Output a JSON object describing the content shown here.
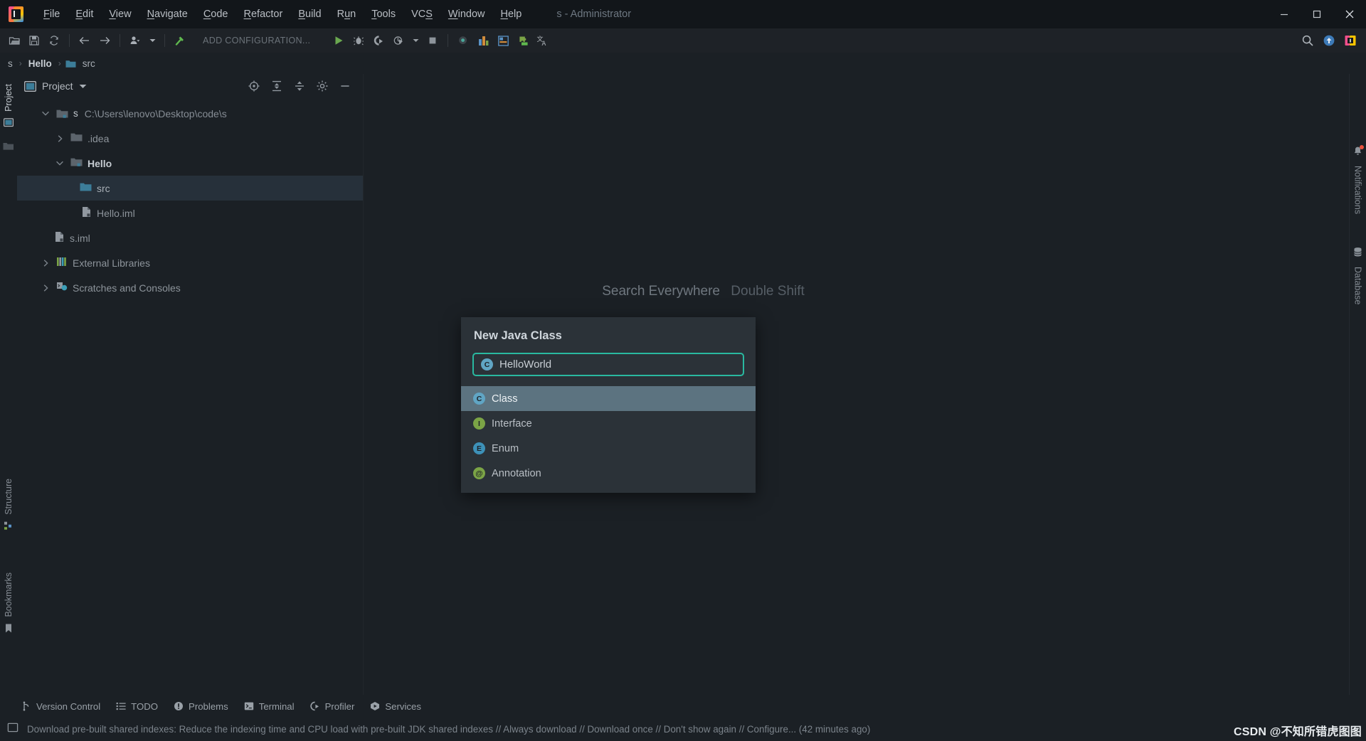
{
  "window": {
    "title": "s - Administrator",
    "controls": [
      "minimize",
      "maximize",
      "close"
    ]
  },
  "menubar": {
    "logo": "intellij-idea-logo",
    "items": [
      {
        "label": "File",
        "mnemonic": "F"
      },
      {
        "label": "Edit",
        "mnemonic": "E"
      },
      {
        "label": "View",
        "mnemonic": "V"
      },
      {
        "label": "Navigate",
        "mnemonic": "N"
      },
      {
        "label": "Code",
        "mnemonic": "C"
      },
      {
        "label": "Refactor",
        "mnemonic": "R"
      },
      {
        "label": "Build",
        "mnemonic": "B"
      },
      {
        "label": "Run",
        "mnemonic": "u"
      },
      {
        "label": "Tools",
        "mnemonic": "T"
      },
      {
        "label": "VCS",
        "mnemonic": "S"
      },
      {
        "label": "Window",
        "mnemonic": "W"
      },
      {
        "label": "Help",
        "mnemonic": "H"
      }
    ]
  },
  "toolbar": {
    "add_configuration": "ADD CONFIGURATION...",
    "icons_left": [
      "open-folder-icon",
      "save-icon",
      "sync-icon",
      "back-arrow-icon",
      "forward-arrow-icon",
      "user-icon",
      "build-hammer-icon"
    ],
    "icons_run": [
      "run-icon",
      "debug-icon",
      "run-with-coverage-icon",
      "profile-icon",
      "stop-icon"
    ],
    "icons_extra": [
      "search-everywhere-icon",
      "layout-icon",
      "ui-designer-icon",
      "plugin-icon",
      "translate-icon"
    ],
    "icons_right": [
      "search-icon",
      "update-project-icon",
      "ide-icon"
    ]
  },
  "breadcrumb": {
    "items": [
      {
        "label": "s",
        "style": "plain"
      },
      {
        "label": "Hello",
        "style": "bold"
      },
      {
        "label": "src",
        "style": "folder"
      }
    ],
    "separator": "›"
  },
  "project_panel": {
    "title": "Project",
    "view_icon": "project-view-icon",
    "chevron": "▾",
    "actions": [
      "select-opened-file-icon",
      "expand-all-icon",
      "collapse-all-icon",
      "settings-gear-icon",
      "hide-panel-icon"
    ],
    "tree": [
      {
        "label": "C:\\Users\\lenovo\\Desktop\\code\\s",
        "module": "s",
        "indent": 0,
        "state": "expanded",
        "icon": "module-folder-icon",
        "style": "path",
        "selected": false
      },
      {
        "label": ".idea",
        "indent": 1,
        "state": "collapsed",
        "icon": "folder-icon",
        "style": "dim",
        "selected": false
      },
      {
        "label": "Hello",
        "indent": 1,
        "state": "expanded",
        "icon": "module-folder-icon",
        "style": "bold",
        "selected": false
      },
      {
        "label": "src",
        "indent": 2,
        "state": "leaf",
        "icon": "source-folder-icon",
        "style": "normal",
        "selected": true
      },
      {
        "label": "Hello.iml",
        "indent": 2,
        "state": "leaf",
        "icon": "iml-file-icon",
        "style": "dim",
        "selected": false
      },
      {
        "label": "s.iml",
        "indent": 1,
        "state": "leaf",
        "icon": "iml-file-icon",
        "style": "dim",
        "selected": false
      },
      {
        "label": "External Libraries",
        "indent": 0,
        "state": "collapsed",
        "icon": "external-libraries-icon",
        "style": "dim",
        "selected": false
      },
      {
        "label": "Scratches and Consoles",
        "indent": 0,
        "state": "collapsed",
        "icon": "scratches-icon",
        "style": "dim",
        "selected": false
      }
    ]
  },
  "editor": {
    "search_everywhere_label": "Search Everywhere",
    "search_everywhere_shortcut": "Double Shift"
  },
  "popup": {
    "title": "New Java Class",
    "input_value": "HelloWorld",
    "input_icon": "class-badge-icon",
    "input_border_color": "#29b9a0",
    "options": [
      {
        "label": "Class",
        "badge": "C",
        "badge_color": "#60a5c4",
        "selected": true,
        "icon": "class-badge-icon"
      },
      {
        "label": "Interface",
        "badge": "I",
        "badge_color": "#7ba446",
        "selected": false,
        "icon": "interface-badge-icon"
      },
      {
        "label": "Enum",
        "badge": "E",
        "badge_color": "#3d91b8",
        "selected": false,
        "icon": "enum-badge-icon"
      },
      {
        "label": "Annotation",
        "badge": "@",
        "badge_color": "#7ba446",
        "selected": false,
        "icon": "annotation-badge-icon"
      }
    ]
  },
  "left_strip": {
    "items": [
      {
        "label": "Project",
        "icon": "project-tool-icon",
        "active": true
      },
      {
        "label": "Structure",
        "icon": "structure-tool-icon",
        "active": false
      },
      {
        "label": "Bookmarks",
        "icon": "bookmarks-tool-icon",
        "active": false
      }
    ]
  },
  "right_strip": {
    "items": [
      {
        "label": "Notifications",
        "icon": "notifications-bell-icon",
        "badge": true
      },
      {
        "label": "Database",
        "icon": "database-icon",
        "badge": false
      }
    ]
  },
  "bottom_bar": {
    "items": [
      {
        "label": "Version Control",
        "icon": "version-control-icon"
      },
      {
        "label": "TODO",
        "icon": "todo-icon"
      },
      {
        "label": "Problems",
        "icon": "problems-icon"
      },
      {
        "label": "Terminal",
        "icon": "terminal-icon"
      },
      {
        "label": "Profiler",
        "icon": "profiler-icon"
      },
      {
        "label": "Services",
        "icon": "services-icon"
      }
    ]
  },
  "status_bar": {
    "icon": "ide-status-icon",
    "message": "Download pre-built shared indexes: Reduce the indexing time and CPU load with pre-built JDK shared indexes // Always download // Download once // Don't show again // Configure... (42 minutes ago)"
  },
  "watermark": {
    "text": "CSDN @不知所错虎图图"
  }
}
